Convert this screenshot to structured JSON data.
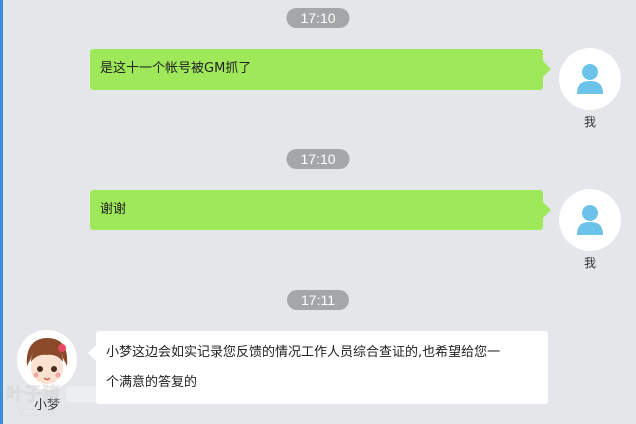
{
  "messages": [
    {
      "time": "17:10",
      "sender": "我",
      "text": "是这十一个帐号被GM抓了"
    },
    {
      "time": "17:10",
      "sender": "我",
      "text": "谢谢"
    },
    {
      "time": "17:11",
      "sender": "小梦",
      "text_line1": "小梦这边会如实记录您反馈的情况工作人员综合查证的,也希望给您一",
      "text_line2": "个满意的答复的"
    }
  ],
  "watermark": {
    "brand": "叶子猪",
    "url": "YZZ.CN"
  },
  "colors": {
    "background": "#e5e6ea",
    "sent_bubble": "#9fe85a",
    "received_bubble": "#ffffff",
    "time_badge": "#a5a6a8",
    "user_icon": "#6cc3ea"
  },
  "icons": {
    "user_avatar": "user-silhouette-icon",
    "agent_avatar": "cartoon-girl-avatar"
  }
}
